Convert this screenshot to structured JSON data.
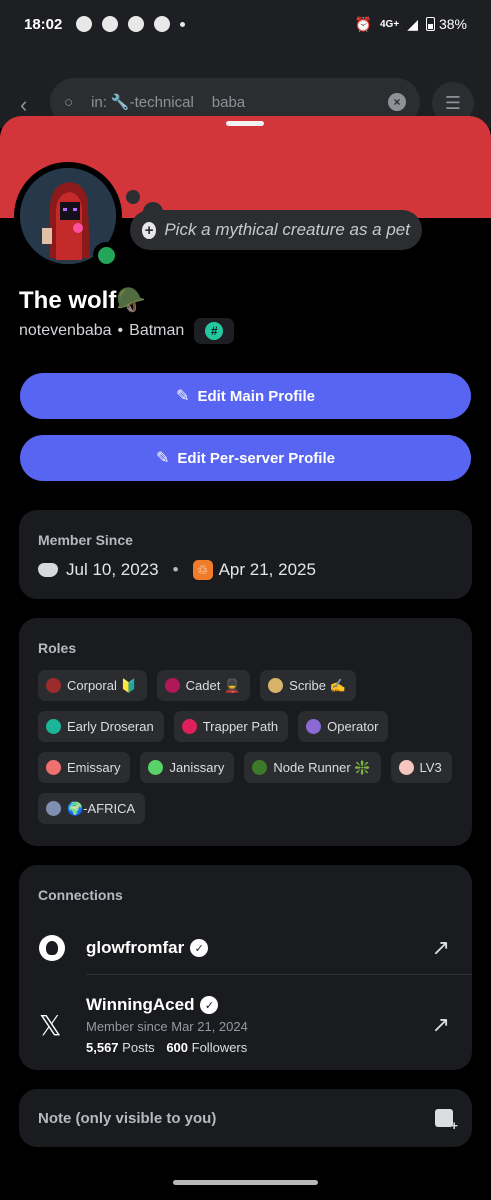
{
  "status_bar": {
    "time": "18:02",
    "network": "4G+",
    "battery": "38%"
  },
  "search": {
    "filter_prefix": "in:",
    "channel": "🔧-technical",
    "query": "baba"
  },
  "profile": {
    "banner_color": "#d3363a",
    "custom_status": "Pick a mythical creature as a pet",
    "display_name": "The wolf🪖",
    "username": "notevenbaba",
    "pronouns": "Batman",
    "separator": "•",
    "server_tag_glyph": "#",
    "online_status_color": "#23a55a"
  },
  "buttons": {
    "edit_main": "Edit Main Profile",
    "edit_server": "Edit Per-server Profile",
    "accent": "#5865f2"
  },
  "member_since": {
    "title": "Member Since",
    "discord_date": "Jul 10, 2023",
    "server_date": "Apr 21, 2025",
    "server_icon": "♲"
  },
  "roles": {
    "title": "Roles",
    "items": [
      {
        "label": "Corporal 🔰",
        "color": "#9b2c2c"
      },
      {
        "label": "Cadet 💂",
        "color": "#b1185a"
      },
      {
        "label": "Scribe ✍️",
        "color": "#d7b46a"
      },
      {
        "label": "Early Droseran",
        "color": "#1bb59a"
      },
      {
        "label": "Trapper Path",
        "color": "#e0205a"
      },
      {
        "label": "Operator",
        "color": "#8b6ad6"
      },
      {
        "label": "Emissary",
        "color": "#f06f6f"
      },
      {
        "label": "Janissary",
        "color": "#57d36a"
      },
      {
        "label": "Node Runner ❇️",
        "color": "#3c7a2a"
      },
      {
        "label": "LV3",
        "color": "#f5c6c0"
      },
      {
        "label": "🌍-AFRICA",
        "color": "#7f8fb0"
      }
    ]
  },
  "connections": {
    "title": "Connections",
    "github": {
      "name": "glowfromfar"
    },
    "x": {
      "name": "WinningAced",
      "since": "Member since Mar 21, 2024",
      "posts_count": "5,567",
      "posts_label": "Posts",
      "followers_count": "600",
      "followers_label": "Followers"
    }
  },
  "note": {
    "placeholder": "Note (only visible to you)"
  }
}
